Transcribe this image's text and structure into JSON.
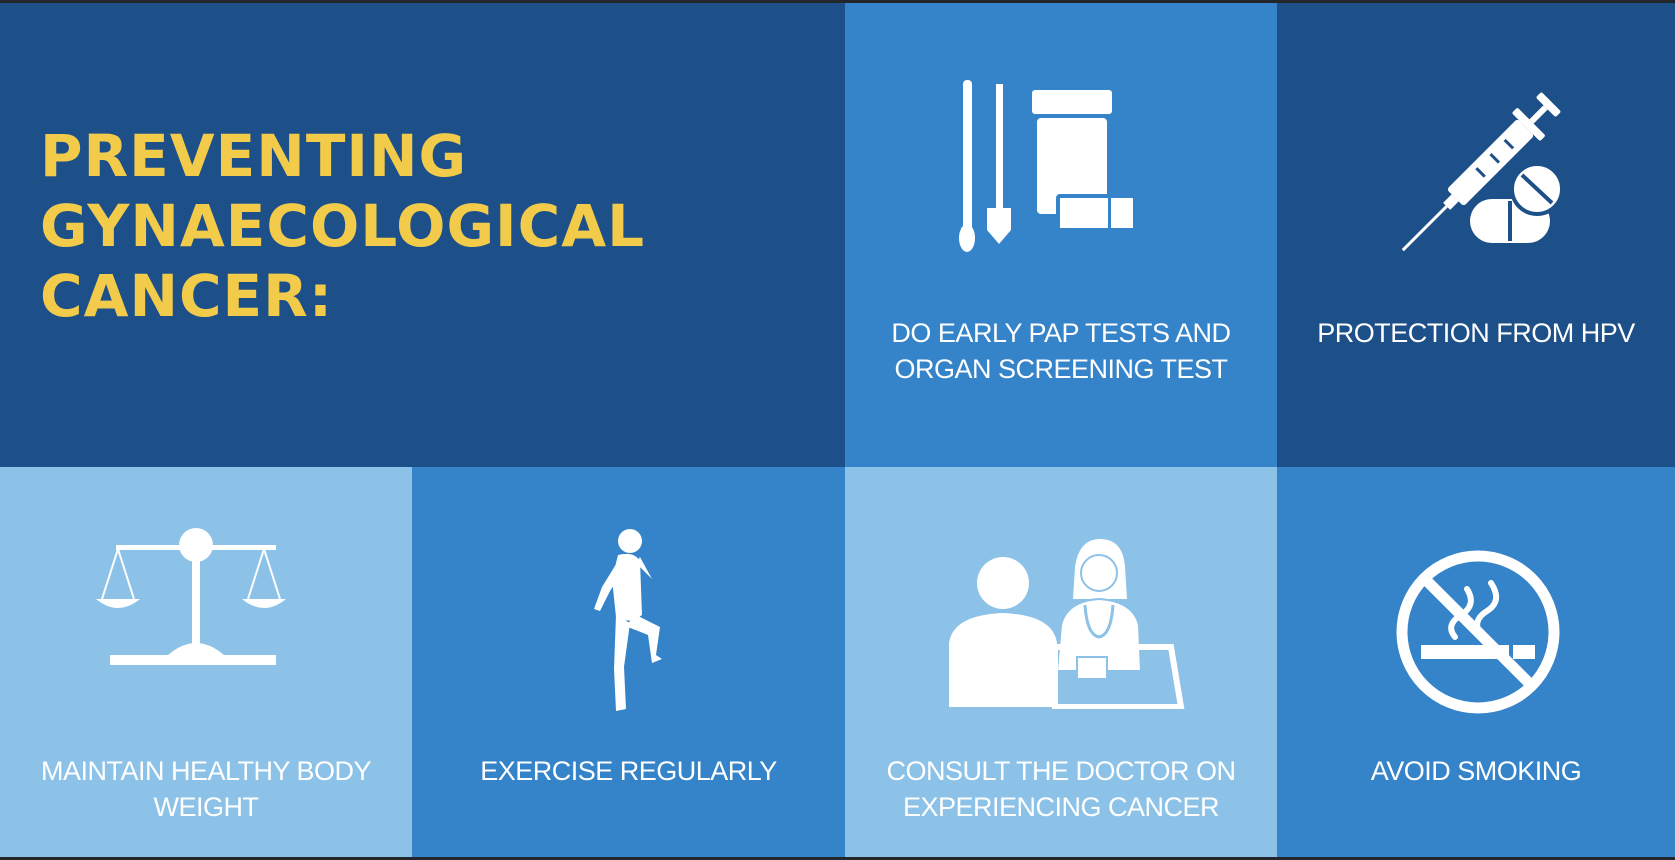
{
  "headline": {
    "lines": [
      "PREVENTING",
      "GYNAECOLOGICAL",
      "CANCER:"
    ]
  },
  "tiles": {
    "pap": {
      "lines": [
        "DO EARLY PAP TESTS AND",
        "ORGAN SCREENING TEST"
      ],
      "icon": "swab-and-specimen-jar-icon"
    },
    "hpv": {
      "lines": [
        "PROTECTION FROM HPV"
      ],
      "icon": "syringe-and-pills-icon"
    },
    "weight": {
      "lines": [
        "MAINTAIN HEALTHY BODY",
        "WEIGHT"
      ],
      "icon": "balance-scale-icon"
    },
    "exercise": {
      "lines": [
        "EXERCISE REGULARLY"
      ],
      "icon": "runner-icon"
    },
    "doctor": {
      "lines": [
        "CONSULT THE DOCTOR ON",
        "EXPERIENCING CANCER"
      ],
      "icon": "doctor-consultation-icon"
    },
    "smoke": {
      "lines": [
        "AVOID SMOKING"
      ],
      "icon": "no-smoking-icon"
    }
  },
  "colors": {
    "dark_blue": "#1d5089",
    "mid_blue": "#3583c8",
    "light_blue": "#8cc2e8",
    "headline_yellow": "#f2cb4b",
    "icon_white": "#ffffff"
  }
}
